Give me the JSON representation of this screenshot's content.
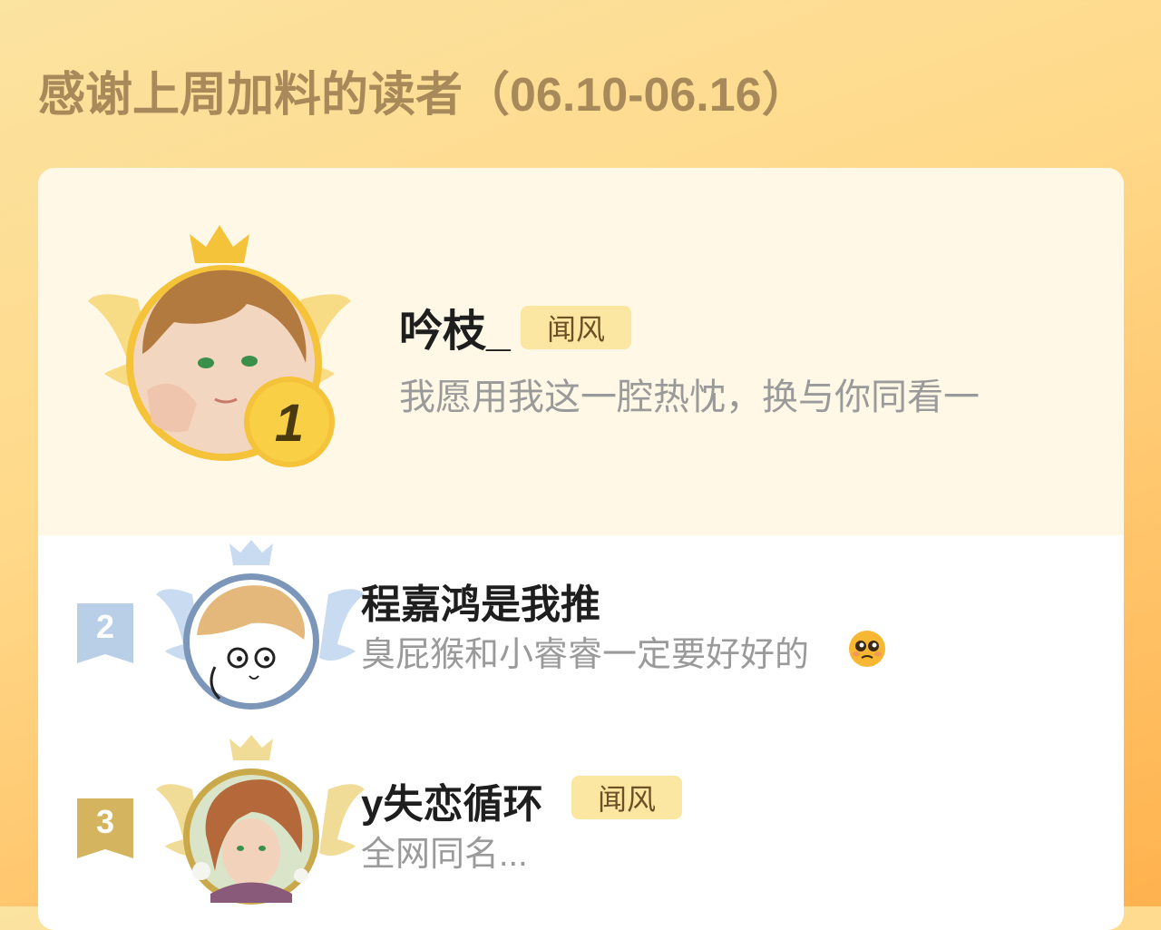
{
  "header": {
    "title": "感谢上周加料的读者（06.10-06.16）"
  },
  "readers": [
    {
      "rank": "1",
      "name": "吟枝_",
      "badge": "闻风",
      "message": "我愿用我这一腔热忱，换与你同看一",
      "frame_color": "#f5c33a"
    },
    {
      "rank": "2",
      "name": "程嘉鸿是我推",
      "badge": "",
      "message": "臭屁猴和小睿睿一定要好好的",
      "emoji": "pleading-face-icon",
      "frame_color": "#7b96b8"
    },
    {
      "rank": "3",
      "name": "y失恋循环",
      "badge": "闻风",
      "message": "全网同名...",
      "frame_color": "#c9a94a"
    }
  ],
  "colors": {
    "accent": "#ffb24e",
    "title": "#a88a5a",
    "badge_bg": "#fbe7a2",
    "gold": "#f5c33a",
    "silver": "#9fc0e6",
    "bronze": "#d4b45e"
  }
}
